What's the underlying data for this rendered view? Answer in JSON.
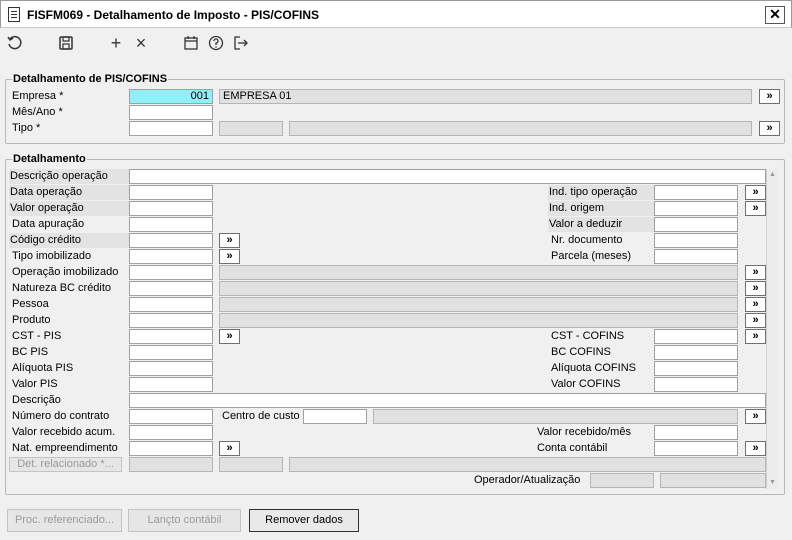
{
  "window": {
    "title": "FISFM069 - Detalhamento de Imposto - PIS/COFINS",
    "close": "✕"
  },
  "toolbar": {
    "add": "+",
    "remove": "×"
  },
  "header": {
    "title": "Detalhamento de PIS/COFINS",
    "empresa_label": "Empresa *",
    "empresa_code": "001",
    "empresa_name": "EMPRESA 01",
    "mes_ano_label": "Mês/Ano *",
    "tipo_label": "Tipo *"
  },
  "detail": {
    "title": "Detalhamento",
    "descricao_operacao": "Descrição operação",
    "data_operacao": "Data operação",
    "valor_operacao": "Valor operação",
    "data_apuracao": "Data apuração",
    "codigo_credito": "Código crédito",
    "tipo_imobilizado": "Tipo imobilizado",
    "operacao_imobilizado": "Operação imobilizado",
    "natureza_bc_credito": "Natureza BC crédito",
    "pessoa": "Pessoa",
    "produto": "Produto",
    "cst_pis": "CST - PIS",
    "bc_pis": "BC PIS",
    "aliquota_pis": "Alíquota PIS",
    "valor_pis": "Valor PIS",
    "descricao": "Descrição",
    "numero_contrato": "Número do contrato",
    "centro_custo": "Centro de custo",
    "valor_recebido_acum": "Valor recebido acum.",
    "nat_empreendimento": "Nat. empreendimento",
    "det_relacionado": "Det. relacionado *...",
    "ind_tipo_operacao": "Ind. tipo operação",
    "ind_origem": "Ind. origem",
    "valor_deduzir": "Valor a deduzir",
    "nr_documento": "Nr. documento",
    "parcela_meses": "Parcela (meses)",
    "cst_cofins": "CST - COFINS",
    "bc_cofins": "BC COFINS",
    "aliquota_cofins": "Alíquota COFINS",
    "valor_cofins": "Valor COFINS",
    "valor_recebido_mes": "Valor recebido/mês",
    "conta_contabil": "Conta contábil",
    "operador_atualizacao": "Operador/Atualização"
  },
  "lookup": "»",
  "buttons": {
    "proc_referenciado": "Proc. referenciado...",
    "lancto_contabil": "Lançto contábil",
    "remover_dados": "Remover dados"
  },
  "scroll": {
    "up": "▲",
    "down": "▼"
  }
}
